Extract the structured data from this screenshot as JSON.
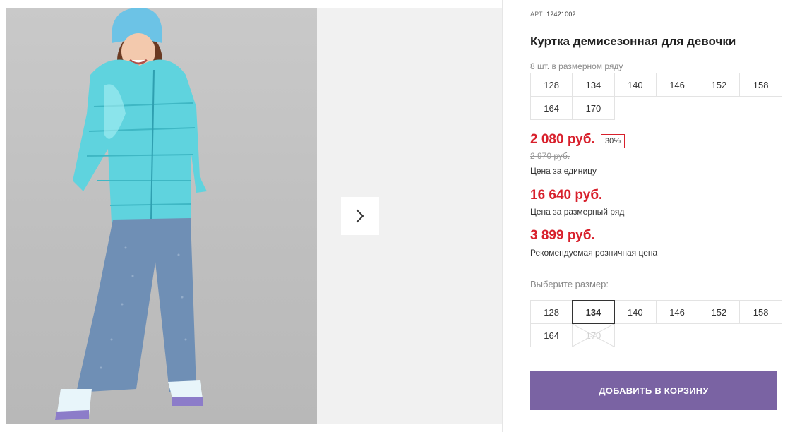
{
  "gallery": {
    "photo_alt": "photo",
    "next_icon": "chevron-right-icon"
  },
  "product": {
    "article_label": "АРТ:",
    "article_number": "12421002",
    "title": "Куртка демисезонная для девочки",
    "pack_info": "8 шт. в размерном ряду",
    "size_row": [
      "128",
      "134",
      "140",
      "146",
      "152",
      "158",
      "164",
      "170"
    ]
  },
  "prices": {
    "unit_price": "2 080 руб.",
    "discount": "30%",
    "old_price": "2 970 руб.",
    "unit_caption": "Цена за единицу",
    "row_price": "16 640 руб.",
    "row_caption": "Цена за размерный ряд",
    "rrp_price": "3 899 руб.",
    "rrp_caption": "Рекомендуемая розничная цена"
  },
  "size_selector": {
    "label": "Выберите размер:",
    "sizes": [
      {
        "size": "128",
        "state": "available"
      },
      {
        "size": "134",
        "state": "selected"
      },
      {
        "size": "140",
        "state": "available"
      },
      {
        "size": "146",
        "state": "available"
      },
      {
        "size": "152",
        "state": "available"
      },
      {
        "size": "158",
        "state": "available"
      },
      {
        "size": "164",
        "state": "available"
      },
      {
        "size": "170",
        "state": "unavailable"
      }
    ]
  },
  "cart": {
    "add_label": "ДОБАВИТЬ В КОРЗИНУ"
  },
  "colors": {
    "price_red": "#d8202c",
    "button_purple": "#7a63a3",
    "jacket": "#5fd3de",
    "jeans": "#6f8fb5"
  }
}
